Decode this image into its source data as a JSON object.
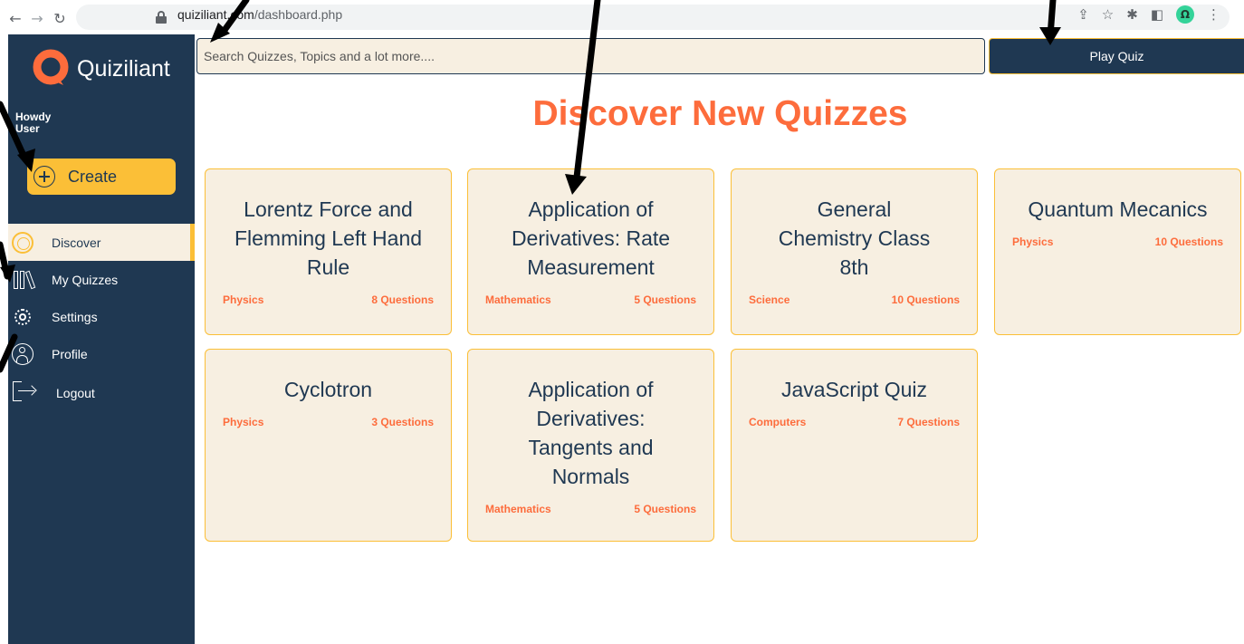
{
  "browser": {
    "url_host": "quiziliant.com",
    "url_path": "/dashboard.php",
    "profile_initial": "Ω"
  },
  "sidebar": {
    "brand_name": "Quiziliant",
    "greeting_line1": "Howdy",
    "greeting_line2": "User",
    "create_label": "Create",
    "items": [
      {
        "label": "Discover",
        "icon": "compass-icon",
        "active": true
      },
      {
        "label": "My Quizzes",
        "icon": "books-icon"
      },
      {
        "label": "Settings",
        "icon": "gear-icon"
      },
      {
        "label": "Profile",
        "icon": "person-icon"
      },
      {
        "label": "Logout",
        "icon": "logout-icon"
      }
    ]
  },
  "search": {
    "placeholder": "Search Quizzes, Topics and a lot more...."
  },
  "play_button": "Play Quiz",
  "page_title": "Discover New Quizzes",
  "quizzes": [
    {
      "title": "Lorentz Force and Flemming Left Hand Rule",
      "subject": "Physics",
      "questions": "8 Questions"
    },
    {
      "title": "Application of Derivatives: Rate Measurement",
      "subject": "Mathematics",
      "questions": "5 Questions"
    },
    {
      "title": "General Chemistry Class 8th",
      "subject": "Science",
      "questions": "10 Questions"
    },
    {
      "title": "Quantum Mecanics",
      "subject": "Physics",
      "questions": "10 Questions"
    },
    {
      "title": "Cyclotron",
      "subject": "Physics",
      "questions": "3 Questions"
    },
    {
      "title": "Application of Derivatives: Tangents and Normals",
      "subject": "Mathematics",
      "questions": "5 Questions"
    },
    {
      "title": "JavaScript Quiz",
      "subject": "Computers",
      "questions": "7 Questions"
    }
  ],
  "colors": {
    "sidebar": "#1f3852",
    "accent": "#fbbf37",
    "brand_orange": "#fd6c3c",
    "card_bg": "#f7efe1"
  }
}
